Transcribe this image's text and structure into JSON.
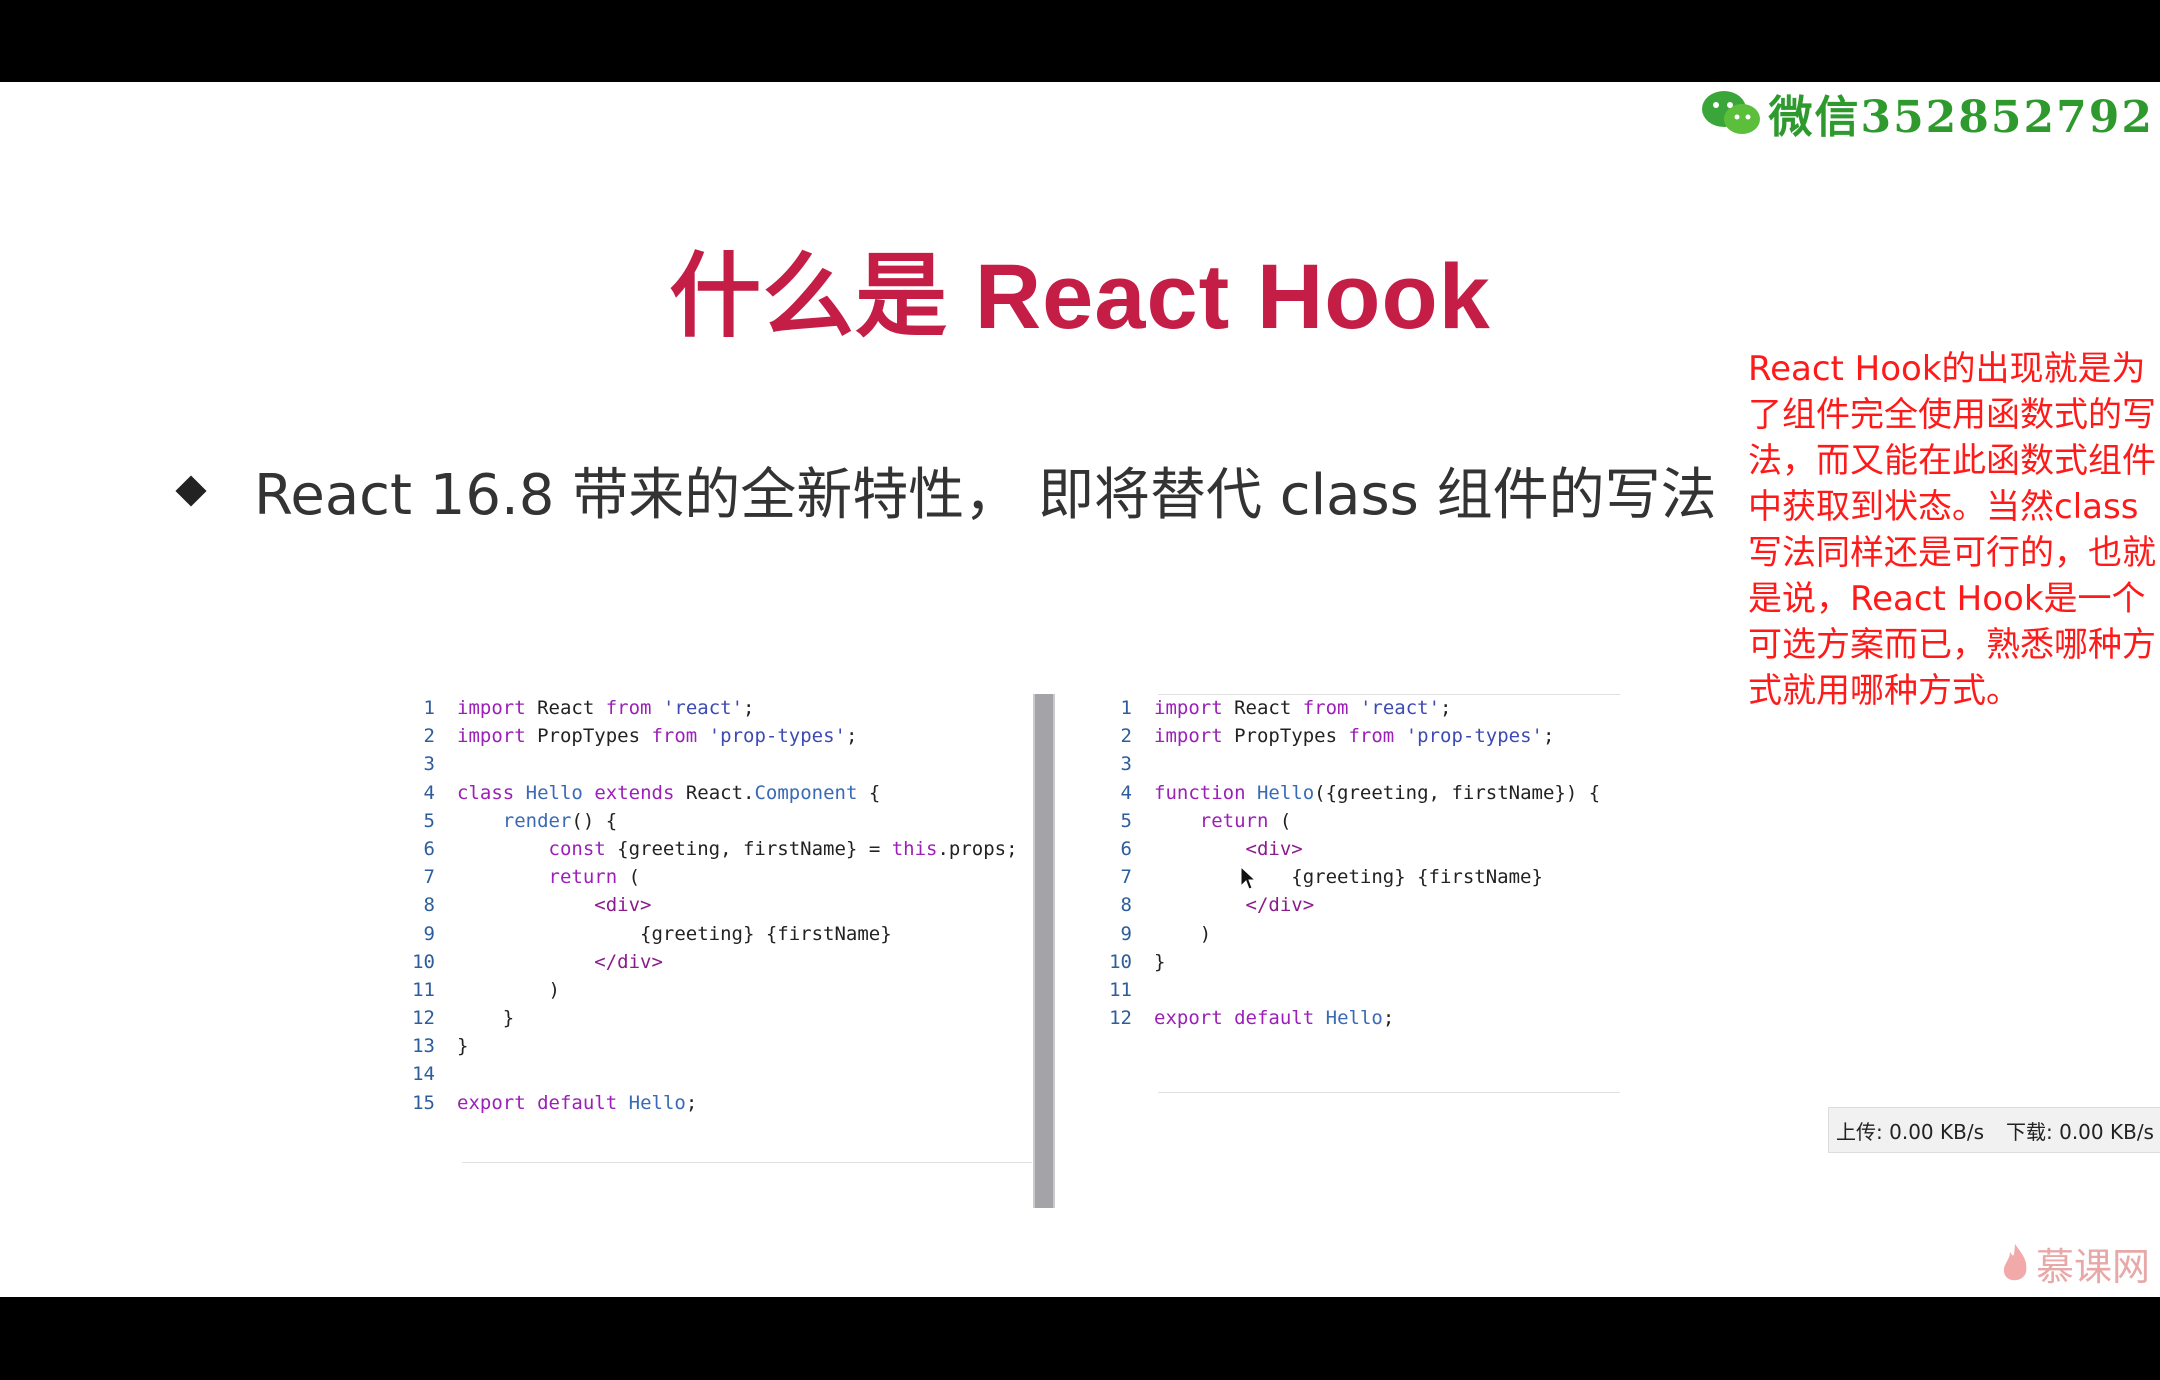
{
  "watermark": {
    "text": "微信352852792",
    "icon": "wechat-icon"
  },
  "slide": {
    "title": "什么是 React Hook",
    "bullet": "React 16.8 带来的全新特性， 即将替代 class 组件的写法"
  },
  "note": {
    "text": "React Hook的出现就是为了组件完全使用函数式的写法，而又能在此函数式组件中获取到状态。当然class写法同样还是可行的，也就是说，React Hook是一个可选方案而已，熟悉哪种方式就用哪种方式。"
  },
  "code_left": {
    "lines": [
      {
        "n": "1",
        "code": "import React from 'react';"
      },
      {
        "n": "2",
        "code": "import PropTypes from 'prop-types';"
      },
      {
        "n": "3",
        "code": ""
      },
      {
        "n": "4",
        "code": "class Hello extends React.Component {"
      },
      {
        "n": "5",
        "code": "    render() {"
      },
      {
        "n": "6",
        "code": "        const {greeting, firstName} = this.props;"
      },
      {
        "n": "7",
        "code": "        return ("
      },
      {
        "n": "8",
        "code": "            <div>"
      },
      {
        "n": "9",
        "code": "                {greeting} {firstName}"
      },
      {
        "n": "10",
        "code": "            </div>"
      },
      {
        "n": "11",
        "code": "        )"
      },
      {
        "n": "12",
        "code": "    }"
      },
      {
        "n": "13",
        "code": "}"
      },
      {
        "n": "14",
        "code": ""
      },
      {
        "n": "15",
        "code": "export default Hello;"
      }
    ]
  },
  "code_right": {
    "lines": [
      {
        "n": "1",
        "code": "import React from 'react';"
      },
      {
        "n": "2",
        "code": "import PropTypes from 'prop-types';"
      },
      {
        "n": "3",
        "code": ""
      },
      {
        "n": "4",
        "code": "function Hello({greeting, firstName}) {"
      },
      {
        "n": "5",
        "code": "    return ("
      },
      {
        "n": "6",
        "code": "        <div>"
      },
      {
        "n": "7",
        "code": "            {greeting} {firstName}"
      },
      {
        "n": "8",
        "code": "        </div>"
      },
      {
        "n": "9",
        "code": "    )"
      },
      {
        "n": "10",
        "code": "}"
      },
      {
        "n": "11",
        "code": ""
      },
      {
        "n": "12",
        "code": "export default Hello;"
      }
    ]
  },
  "status": {
    "upload": "上传: 0.00 KB/s",
    "download": "下载: 0.00 KB/s"
  },
  "brand": {
    "text": "慕课网",
    "icon": "flame-icon"
  }
}
